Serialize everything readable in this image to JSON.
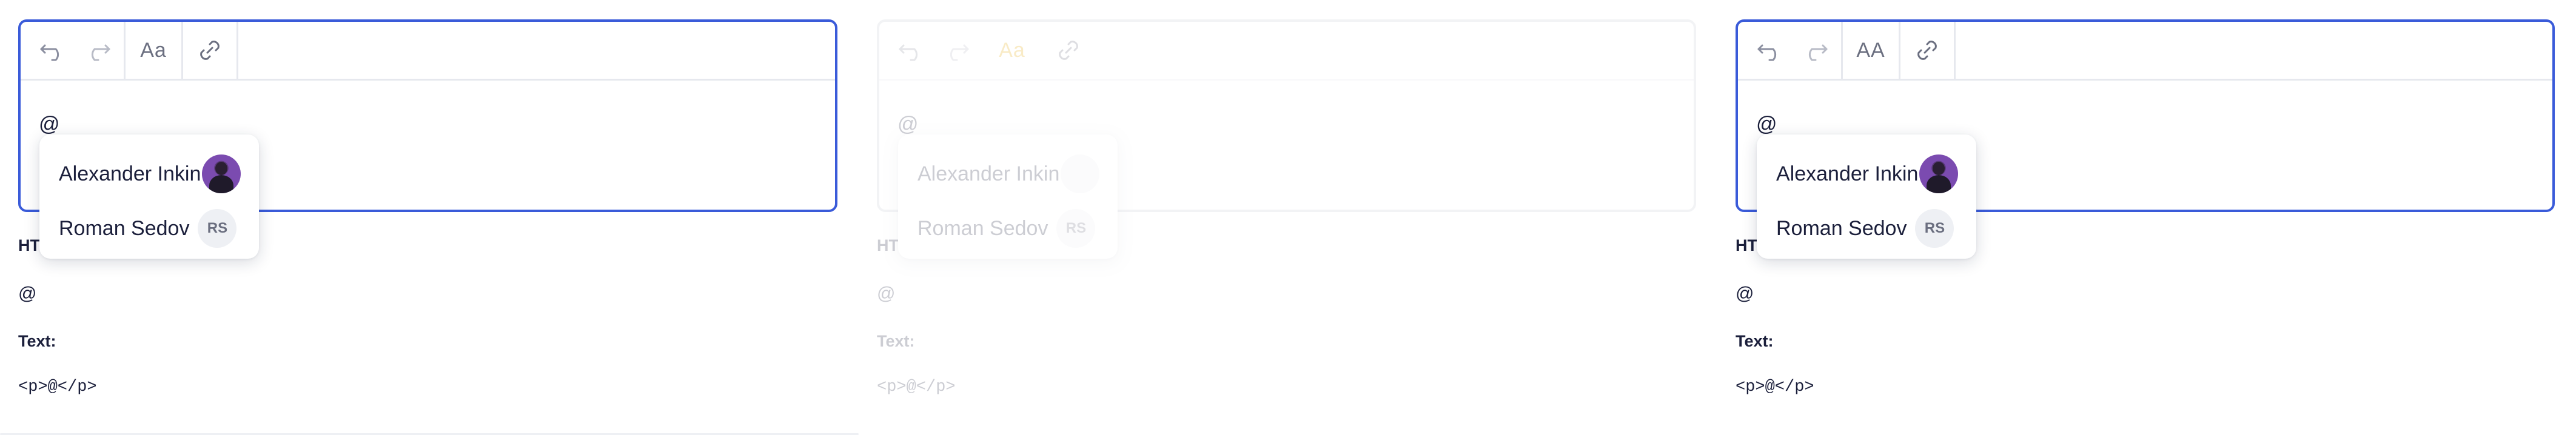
{
  "panels": [
    {
      "state": "active",
      "toolbar": {
        "undo_icon": "undo-icon",
        "redo_icon": "redo-icon",
        "font_label": "Aa",
        "link_icon": "link-icon"
      },
      "editor_content": "@",
      "mentions": [
        {
          "name": "Alexander Inkin",
          "avatar": "photo"
        },
        {
          "name": "Roman Sedov",
          "initials": "RS"
        }
      ],
      "html_label": "HTML:",
      "html_value": "@",
      "text_label": "Text:",
      "text_value": "<p>@</p>"
    },
    {
      "state": "faded",
      "toolbar": {
        "undo_icon": "undo-icon",
        "redo_icon": "redo-icon",
        "font_label": "Aa",
        "link_icon": "link-icon"
      },
      "editor_content": "@",
      "mentions": [
        {
          "name": "Alexander Inkin",
          "avatar": "photo"
        },
        {
          "name": "Roman Sedov",
          "initials": "RS"
        }
      ],
      "html_label": "HTML:",
      "html_value": "@",
      "text_label": "Text:",
      "text_value": "<p>@</p>"
    },
    {
      "state": "active",
      "toolbar": {
        "undo_icon": "undo-icon",
        "redo_icon": "redo-icon",
        "font_label": "AA",
        "link_icon": "link-icon"
      },
      "editor_content": "@",
      "mentions": [
        {
          "name": "Alexander Inkin",
          "avatar": "photo"
        },
        {
          "name": "Roman Sedov",
          "initials": "RS"
        }
      ],
      "html_label": "HTML:",
      "html_value": "@",
      "text_label": "Text:",
      "text_value": "<p>@</p>"
    }
  ],
  "colors": {
    "accent_border": "#3a5bd9",
    "font_active": "#e6a800",
    "avatar_bg": "#7b4bb0"
  }
}
